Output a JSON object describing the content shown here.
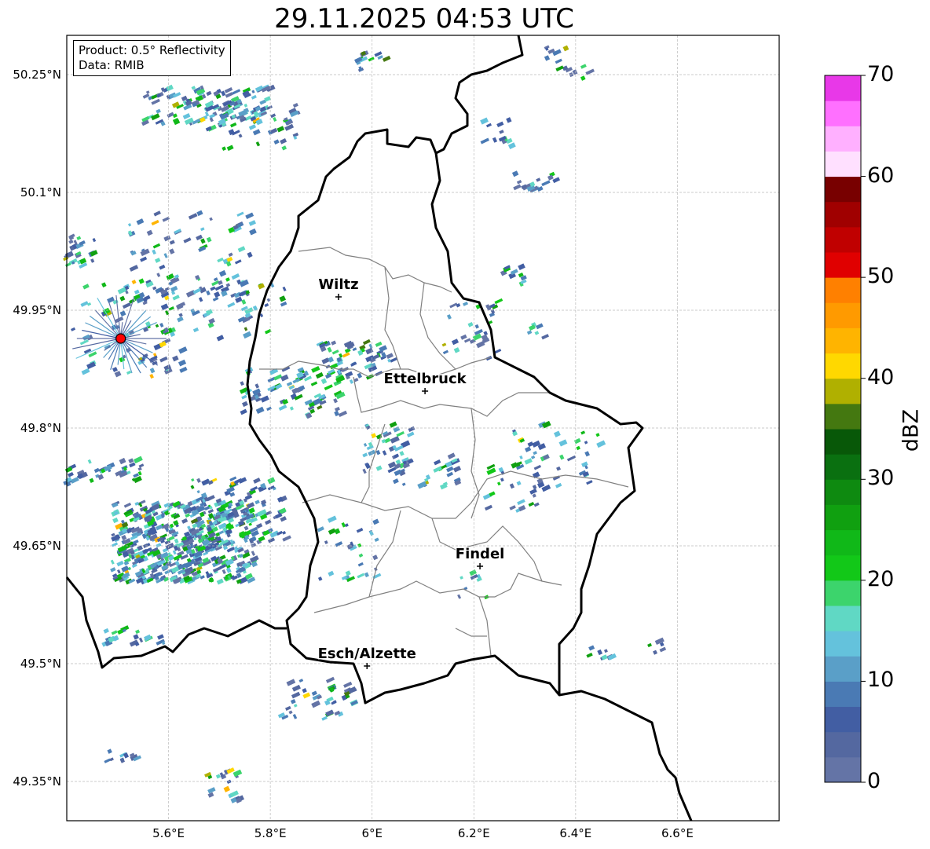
{
  "title": "29.11.2025 04:53 UTC",
  "info": {
    "product": "Product: 0.5° Reflectivity",
    "data": "Data: RMIB"
  },
  "map_extent": {
    "lon": [
      5.4,
      6.8
    ],
    "lat": [
      49.3,
      50.3
    ]
  },
  "y_ticks": [
    {
      "lat": 50.25,
      "label": "50.25°N"
    },
    {
      "lat": 50.1,
      "label": "50.1°N"
    },
    {
      "lat": 49.95,
      "label": "49.95°N"
    },
    {
      "lat": 49.8,
      "label": "49.8°N"
    },
    {
      "lat": 49.65,
      "label": "49.65°N"
    },
    {
      "lat": 49.5,
      "label": "49.5°N"
    },
    {
      "lat": 49.35,
      "label": "49.35°N"
    }
  ],
  "x_ticks": [
    {
      "lon": 5.6,
      "label": "5.6°E"
    },
    {
      "lon": 5.8,
      "label": "5.8°E"
    },
    {
      "lon": 6.0,
      "label": "6°E"
    },
    {
      "lon": 6.2,
      "label": "6.2°E"
    },
    {
      "lon": 6.4,
      "label": "6.4°E"
    },
    {
      "lon": 6.6,
      "label": "6.6°E"
    }
  ],
  "cities": [
    {
      "name": "Wiltz",
      "lon": 5.934,
      "lat": 49.967
    },
    {
      "name": "Ettelbruck",
      "lon": 6.104,
      "lat": 49.847
    },
    {
      "name": "Findel",
      "lon": 6.212,
      "lat": 49.624
    },
    {
      "name": "Esch/Alzette",
      "lon": 5.99,
      "lat": 49.497
    }
  ],
  "radar_site": {
    "lon": 5.506,
    "lat": 49.914,
    "color": "#ff0000"
  },
  "colorbar": {
    "label": "dBZ",
    "range": [
      0,
      70
    ],
    "step": 2.5,
    "ticks": [
      "0",
      "10",
      "20",
      "30",
      "40",
      "50",
      "60",
      "70"
    ],
    "colors": [
      "#6474a6",
      "#5468a0",
      "#425ea3",
      "#4a7ab4",
      "#5a9fc8",
      "#64c2dc",
      "#60d8c4",
      "#3cd46c",
      "#12c818",
      "#10b818",
      "#10a010",
      "#0e8a10",
      "#0a7010",
      "#085808",
      "#447810",
      "#b0b000",
      "#ffd800",
      "#ffb400",
      "#ff9a00",
      "#ff8000",
      "#e00000",
      "#c00000",
      "#a00000",
      "#780000",
      "#ffe0ff",
      "#ffb0ff",
      "#ff70ff",
      "#e838e8"
    ]
  }
}
